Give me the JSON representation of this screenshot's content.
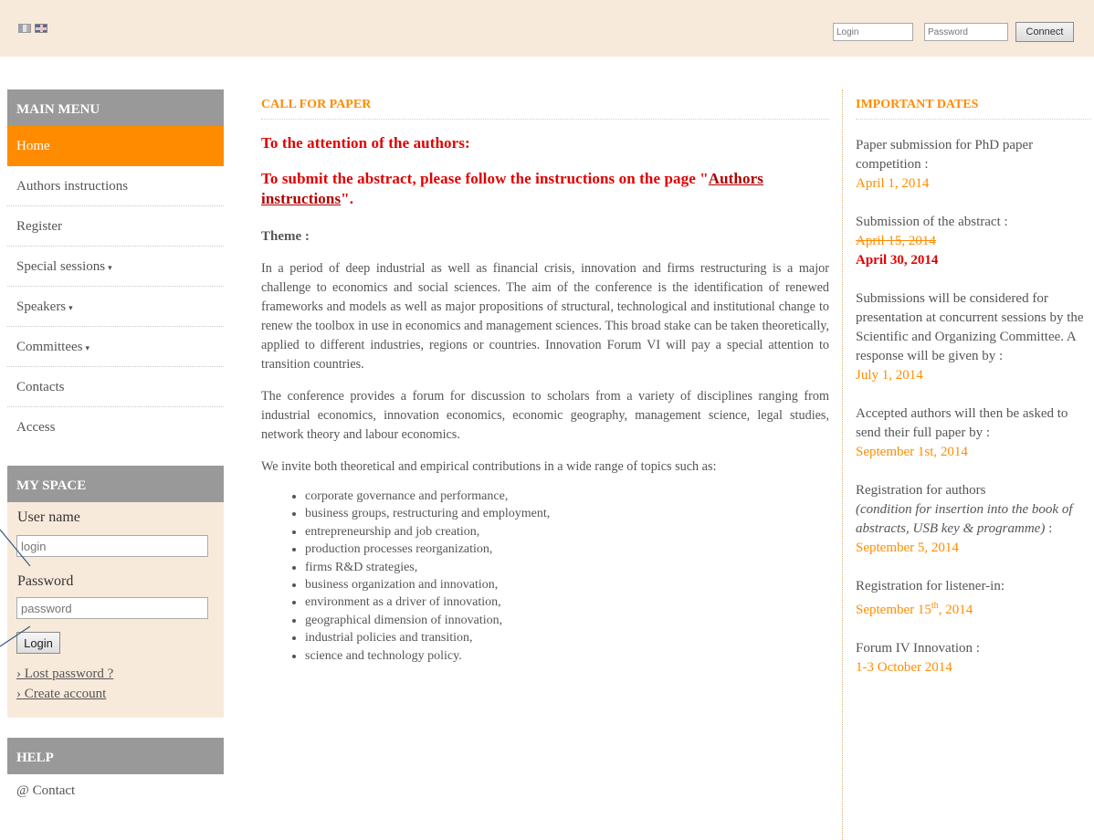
{
  "header": {
    "flags": [
      "french-flag",
      "english-flag"
    ],
    "login_placeholder": "Login",
    "password_placeholder": "Password",
    "connect_label": "Connect"
  },
  "sidebar": {
    "main_menu_title": "MAIN MENU",
    "items": [
      {
        "label": "Home",
        "active": true
      },
      {
        "label": "Authors instructions"
      },
      {
        "label": "Register"
      },
      {
        "label": "Special sessions",
        "has_submenu": true
      },
      {
        "label": "Speakers",
        "has_submenu": true
      },
      {
        "label": "Committees",
        "has_submenu": true
      },
      {
        "label": "Contacts"
      },
      {
        "label": "Access"
      }
    ],
    "submenu_caret": "▾",
    "my_space_title": "MY SPACE",
    "username_label": "User name",
    "username_placeholder": "login",
    "password_label": "Password",
    "password_placeholder": "password",
    "login_button": "Login",
    "lost_password_link": "› Lost password ?",
    "create_account_link": "› Create account",
    "help_title": "HELP",
    "contact_link": "@ Contact"
  },
  "main": {
    "title": "CALL FOR PAPER",
    "attention_heading": "To the attention of the authors:",
    "submit_heading_before": "To submit the abstract, please follow the instructions on the page \"",
    "submit_heading_link": "Authors instructions",
    "submit_heading_after": "\".",
    "theme_label": "Theme :",
    "paragraphs": [
      "In a period of deep industrial as well as financial crisis, innovation and firms restructuring is a major challenge to economics and social sciences. The aim of the conference is the identification of renewed frameworks and models as well as major propositions of structural, technological and institutional change to renew the toolbox in use in economics and management sciences. This broad stake can be taken theoretically, applied to different industries, regions or countries. Innovation Forum VI will pay a special attention to transition countries.",
      "The conference provides a forum for discussion to scholars from a variety of disciplines ranging from industrial economics, innovation economics, economic geography, management science, legal studies, network theory and labour economics.",
      "We invite both theoretical and empirical contributions in a wide range of topics such as:"
    ],
    "topics": [
      "corporate governance and performance,",
      "business groups, restructuring and employment,",
      "entrepreneurship and job creation,",
      "production processes reorganization,",
      "firms R&D strategies,",
      "business organization and innovation,",
      "environment as a driver of innovation,",
      "geographical dimension of innovation,",
      "industrial policies and transition,",
      "science and technology policy."
    ]
  },
  "important_dates": {
    "title": "IMPORTANT DATES",
    "phd_text": "Paper submission for PhD paper competition :",
    "phd_date": "April 1, 2014",
    "abstract_text": "Submission of the abstract :",
    "abstract_old_date": "April 15, 2014",
    "abstract_new_date": "April 30, 2014",
    "consideration_text": "Submissions will be considered for presentation at concurrent sessions by the Scientific and Organizing Committee. A response will be given by :",
    "response_date": "July 1, 2014",
    "full_paper_text": "Accepted authors will then be asked to send their full paper by :",
    "full_paper_date": "September 1st, 2014",
    "registration_authors_text": "Registration for authors",
    "registration_authors_note": "(condition for insertion into the book of abstracts, USB key & programme)",
    "registration_authors_colon": " :",
    "registration_authors_date": "September 5, 2014",
    "listener_text": "Registration for listener-in:",
    "listener_date_prefix": "September 15",
    "listener_date_sup": "th",
    "listener_date_suffix": ", 2014",
    "forum_text": "Forum IV Innovation :",
    "forum_date": "1-3 October 2014"
  },
  "colors": {
    "accent_orange": "#ff8c00",
    "heading_red": "#e00000",
    "header_bg": "#f8eadb",
    "sidebar_heading_bg": "#999999"
  }
}
